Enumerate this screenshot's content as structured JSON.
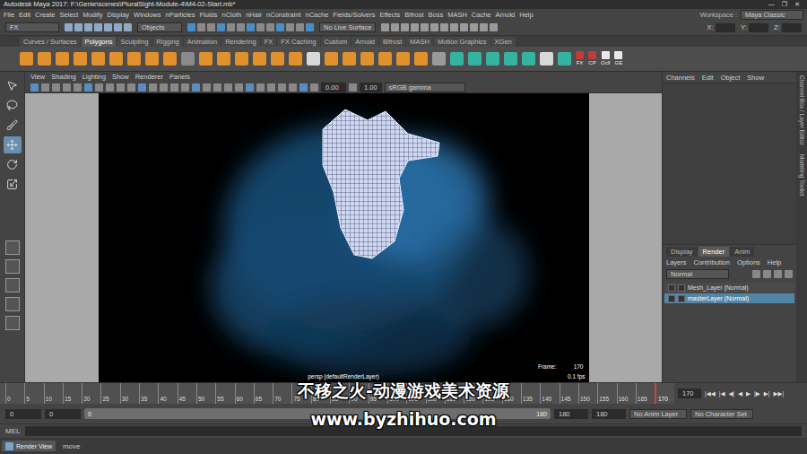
{
  "window": {
    "title": "Autodesk Maya 2017: F:\\Genie\\scenes\\PluralSight-Module-4\\M4-02-Start.mb*",
    "controls": [
      "—",
      "❐",
      "✕"
    ]
  },
  "menubar": {
    "items": [
      "File",
      "Edit",
      "Create",
      "Select",
      "Modify",
      "Display",
      "Windows",
      "nParticles",
      "Fluids",
      "nCloth",
      "nHair",
      "nConstraint",
      "nCache",
      "Fields/Solvers",
      "Effects",
      "Bifrost",
      "Boss",
      "MASH",
      "Cache",
      "Arnold",
      "Help"
    ],
    "workspace_label": "Workspace :",
    "workspace_value": "Maya Classic"
  },
  "status_line": {
    "menu_set": "FX",
    "selection_mode": "Objects",
    "live_surface": "No Live Surface",
    "coords": [
      "X:",
      "Y:",
      "Z:"
    ]
  },
  "shelf": {
    "tabs": [
      {
        "label": "Curves / Surfaces",
        "selected": false
      },
      {
        "label": "Polygons",
        "selected": true
      },
      {
        "label": "Sculpting",
        "selected": false
      },
      {
        "label": "Rigging",
        "selected": false
      },
      {
        "label": "Animation",
        "selected": false
      },
      {
        "label": "Rendering",
        "selected": false
      },
      {
        "label": "FX",
        "selected": false
      },
      {
        "label": "FX Caching",
        "selected": false
      },
      {
        "label": "Custom",
        "selected": false
      },
      {
        "label": "Arnold",
        "selected": false
      },
      {
        "label": "Bifrost",
        "selected": false
      },
      {
        "label": "MASH",
        "selected": false
      },
      {
        "label": "Motion Graphics",
        "selected": false
      },
      {
        "label": "XGen",
        "selected": false
      }
    ],
    "icon_labels": [
      "FX",
      "CP",
      "Ocll",
      "GE"
    ]
  },
  "toolbox": {
    "tools": [
      {
        "selected": false
      },
      {
        "selected": false
      },
      {
        "selected": false
      },
      {
        "selected": true
      },
      {
        "selected": false
      },
      {
        "selected": false
      }
    ]
  },
  "viewport": {
    "menu": [
      "View",
      "Shading",
      "Lighting",
      "Show",
      "Renderer",
      "Panels"
    ],
    "exposure": "0.00",
    "gamma": "1.00",
    "color_space": "sRGB gamma",
    "camera_label": "persp (defaultRenderLayer)",
    "frame_label": "Frame:",
    "frame_value": "170",
    "fps": "0.1 fps"
  },
  "channel_box": {
    "menu": [
      "Channels",
      "Edit",
      "Object",
      "Show"
    ]
  },
  "layer_editor": {
    "tabs": [
      {
        "label": "Display",
        "selected": false
      },
      {
        "label": "Render",
        "selected": true
      },
      {
        "label": "Anim",
        "selected": false
      }
    ],
    "menu": [
      "Layers",
      "Contribution",
      "Options",
      "Help"
    ],
    "blend_mode": "Normal",
    "layers": [
      {
        "name": "Mesh_Layer (Normal)",
        "selected": false
      },
      {
        "name": "masterLayer (Normal)",
        "selected": true
      }
    ]
  },
  "side_tabs": [
    "Channel Box / Layer Editor",
    "Modeling Toolkit"
  ],
  "timeline": {
    "ticks": [
      "0",
      "5",
      "10",
      "15",
      "20",
      "25",
      "30",
      "35",
      "40",
      "45",
      "50",
      "55",
      "60",
      "65",
      "70",
      "75",
      "80",
      "85",
      "90",
      "95",
      "100",
      "105",
      "110",
      "115",
      "120",
      "125",
      "130",
      "135",
      "140",
      "145",
      "150",
      "155",
      "160",
      "165"
    ],
    "marker_label": "170",
    "current_frame": "170",
    "playback": [
      "|◀◀",
      "|◀",
      "◀|",
      "◀",
      "▶",
      "|▶",
      "▶|",
      "▶▶|"
    ]
  },
  "range_slider": {
    "start": "0",
    "range_start": "0",
    "bar_start": "0",
    "bar_end": "180",
    "range_end": "180",
    "end": "180",
    "anim_layer": "No Anim Layer",
    "character_set": "No Character Set"
  },
  "command_line": {
    "language": "MEL"
  },
  "help_line": {
    "tab": "Render View",
    "message": "move"
  },
  "watermark": {
    "title": "不移之火-动漫游戏美术资源",
    "url": "www.byzhihuo.com"
  }
}
